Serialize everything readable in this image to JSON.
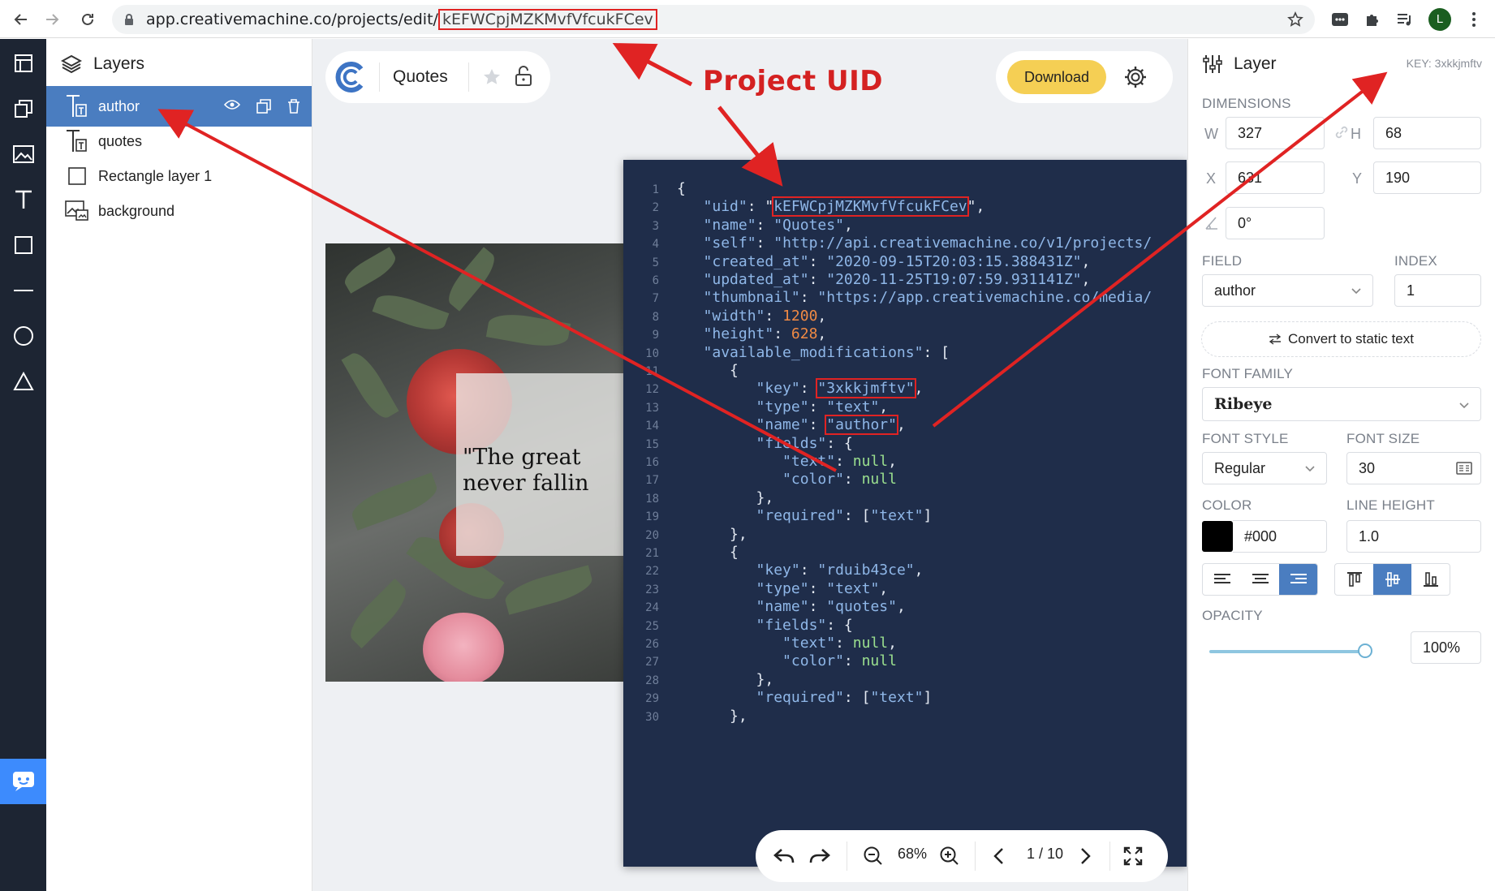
{
  "browser": {
    "url_prefix": "app.creativemachine.co/projects/edit/",
    "url_uid": "kEFWCpjMZKMvfVfcukFCev",
    "avatar_letter": "L"
  },
  "layers_panel": {
    "title": "Layers",
    "items": [
      {
        "label": "author",
        "icon": "text-layer-icon",
        "selected": true
      },
      {
        "label": "quotes",
        "icon": "text-layer-icon",
        "selected": false
      },
      {
        "label": "Rectangle layer 1",
        "icon": "rectangle-icon",
        "selected": false
      },
      {
        "label": "background",
        "icon": "image-layer-icon",
        "selected": false
      }
    ]
  },
  "toolbar": {
    "project_name": "Quotes",
    "download_label": "Download"
  },
  "canvas": {
    "quote_line_1": "\"The great",
    "quote_line_2": "never fallin"
  },
  "zoom_bar": {
    "zoom": "68%",
    "page": "1 / 10"
  },
  "code_lines": [
    {
      "n": "1",
      "html": "<span class='p'>{</span>"
    },
    {
      "n": "2",
      "html": "   <span class='k'>\"uid\"</span><span class='p'>: \"</span><span class='s hl'>kEFWCpjMZKMvfVfcukFCev</span><span class='p'>\",</span>"
    },
    {
      "n": "3",
      "html": "   <span class='k'>\"name\"</span><span class='p'>: </span><span class='s'>\"Quotes\"</span><span class='p'>,</span>"
    },
    {
      "n": "4",
      "html": "   <span class='k'>\"self\"</span><span class='p'>: </span><span class='s'>\"http://api.creativemachine.co/v1/projects/</span>"
    },
    {
      "n": "5",
      "html": "   <span class='k'>\"created_at\"</span><span class='p'>: </span><span class='s'>\"2020-09-15T20:03:15.388431Z\"</span><span class='p'>,</span>"
    },
    {
      "n": "6",
      "html": "   <span class='k'>\"updated_at\"</span><span class='p'>: </span><span class='s'>\"2020-11-25T19:07:59.931141Z\"</span><span class='p'>,</span>"
    },
    {
      "n": "7",
      "html": "   <span class='k'>\"thumbnail\"</span><span class='p'>: </span><span class='s'>\"https://app.creativemachine.co/media/</span>"
    },
    {
      "n": "8",
      "html": "   <span class='k'>\"width\"</span><span class='p'>: </span><span class='n'>1200</span><span class='p'>,</span>"
    },
    {
      "n": "9",
      "html": "   <span class='k'>\"height\"</span><span class='p'>: </span><span class='n'>628</span><span class='p'>,</span>"
    },
    {
      "n": "10",
      "html": "   <span class='k'>\"available_modifications\"</span><span class='p'>: [</span>"
    },
    {
      "n": "11",
      "html": "      <span class='p'>{</span>"
    },
    {
      "n": "12",
      "html": "         <span class='k'>\"key\"</span><span class='p'>: </span><span class='s hl'>\"3xkkjmftv\"</span><span class='p'>,</span>"
    },
    {
      "n": "13",
      "html": "         <span class='k'>\"type\"</span><span class='p'>: </span><span class='s'>\"text\"</span><span class='p'>,</span>"
    },
    {
      "n": "14",
      "html": "         <span class='k'>\"name\"</span><span class='p'>: </span><span class='s hl'>\"author\"</span><span class='p'>,</span>"
    },
    {
      "n": "15",
      "html": "         <span class='k'>\"fields\"</span><span class='p'>: {</span>"
    },
    {
      "n": "16",
      "html": "            <span class='k'>\"text\"</span><span class='p'>: </span><span class='nl'>null</span><span class='p'>,</span>"
    },
    {
      "n": "17",
      "html": "            <span class='k'>\"color\"</span><span class='p'>: </span><span class='nl'>null</span>"
    },
    {
      "n": "18",
      "html": "         <span class='p'>},</span>"
    },
    {
      "n": "19",
      "html": "         <span class='k'>\"required\"</span><span class='p'>: [</span><span class='s'>\"text\"</span><span class='p'>]</span>"
    },
    {
      "n": "20",
      "html": "      <span class='p'>},</span>"
    },
    {
      "n": "21",
      "html": "      <span class='p'>{</span>"
    },
    {
      "n": "22",
      "html": "         <span class='k'>\"key\"</span><span class='p'>: </span><span class='s'>\"rduib43ce\"</span><span class='p'>,</span>"
    },
    {
      "n": "23",
      "html": "         <span class='k'>\"type\"</span><span class='p'>: </span><span class='s'>\"text\"</span><span class='p'>,</span>"
    },
    {
      "n": "24",
      "html": "         <span class='k'>\"name\"</span><span class='p'>: </span><span class='s'>\"quotes\"</span><span class='p'>,</span>"
    },
    {
      "n": "25",
      "html": "         <span class='k'>\"fields\"</span><span class='p'>: {</span>"
    },
    {
      "n": "26",
      "html": "            <span class='k'>\"text\"</span><span class='p'>: </span><span class='nl'>null</span><span class='p'>,</span>"
    },
    {
      "n": "27",
      "html": "            <span class='k'>\"color\"</span><span class='p'>: </span><span class='nl'>null</span>"
    },
    {
      "n": "28",
      "html": "         <span class='p'>},</span>"
    },
    {
      "n": "29",
      "html": "         <span class='k'>\"required\"</span><span class='p'>: [</span><span class='s'>\"text\"</span><span class='p'>]</span>"
    },
    {
      "n": "30",
      "html": "      <span class='p'>},</span>"
    }
  ],
  "props_panel": {
    "title": "Layer",
    "key": "KEY: 3xkkjmftv",
    "dimensions_label": "DIMENSIONS",
    "w_label": "W",
    "w": "327",
    "h_label": "H",
    "h": "68",
    "x_label": "X",
    "x": "631",
    "y_label": "Y",
    "y": "190",
    "rotation": "0°",
    "field_label": "FIELD",
    "field_value": "author",
    "index_label": "INDEX",
    "index_value": "1",
    "convert_label": "Convert to static text",
    "font_family_label": "FONT FAMILY",
    "font_family_value": "Ribeye",
    "font_style_label": "FONT STYLE",
    "font_style_value": "Regular",
    "font_size_label": "FONT SIZE",
    "font_size_value": "30",
    "color_label": "COLOR",
    "color_value": "#000",
    "line_height_label": "LINE HEIGHT",
    "line_height_value": "1.0",
    "opacity_label": "OPACITY",
    "opacity_value": "100%",
    "opacity_fraction": 1.0
  },
  "annotation": {
    "label": "Project UID",
    "color": "#e02323"
  },
  "colors": {
    "accent_blue": "#4a7dc0",
    "download_yellow": "#f5cf54",
    "code_bg": "#1f2d4a",
    "rail_bg": "#1d2533"
  }
}
